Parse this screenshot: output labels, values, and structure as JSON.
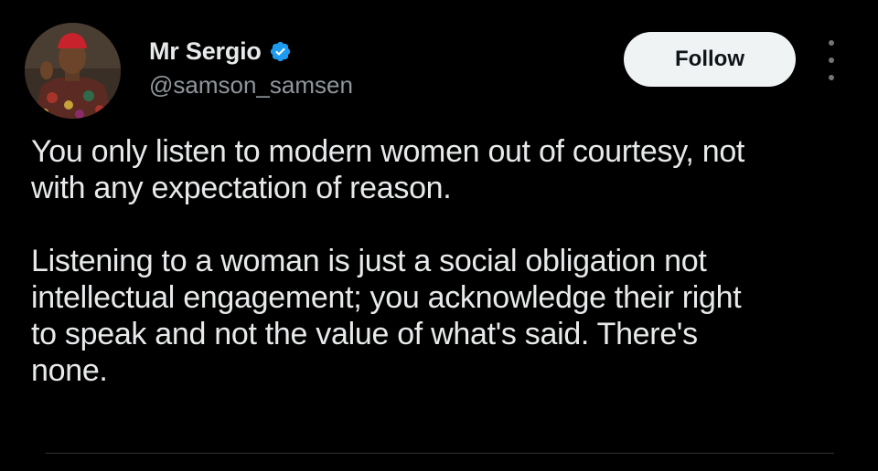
{
  "author": {
    "display_name": "Mr Sergio",
    "handle": "@samson_samsen",
    "verified": true,
    "verified_badge_color": "#1d9bf0"
  },
  "actions": {
    "follow_label": "Follow",
    "more_icon": "more-vertical-icon"
  },
  "tweet": {
    "paragraphs": [
      "You only listen to modern women out of courtesy, not\nwith any expectation of reason.",
      "Listening to a woman is just a social obligation not\nintellectual engagement; you acknowledge their right\nto speak and not the value of  what's said.  There's\nnone."
    ]
  },
  "colors": {
    "background": "#000000",
    "text_primary": "#e7e9ea",
    "text_secondary": "#8f969c",
    "follow_button_bg": "#eff3f4",
    "follow_button_text": "#0f1419"
  }
}
